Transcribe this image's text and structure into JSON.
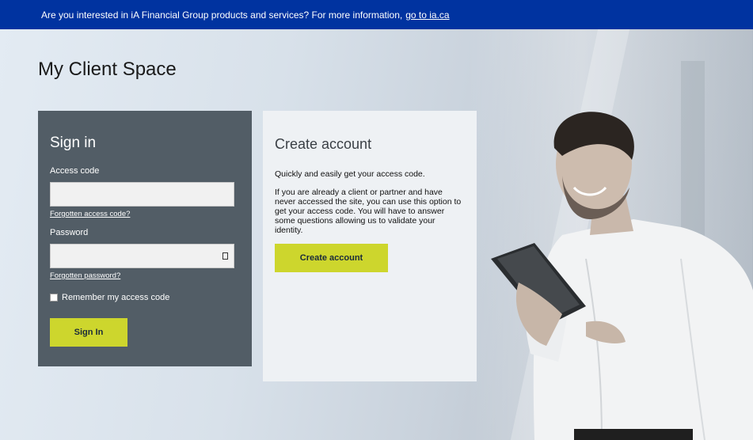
{
  "banner": {
    "text": "Are you interested in iA Financial Group products and services? For more information,",
    "link_text": "go to ia.ca"
  },
  "page_title": "My Client Space",
  "signin": {
    "heading": "Sign in",
    "access_code_label": "Access code",
    "forgot_access_code": "Forgotten access code?",
    "password_label": "Password",
    "forgot_password": "Forgotten password?",
    "remember_label": "Remember my access code",
    "button_label": "Sign In"
  },
  "create_account": {
    "heading": "Create account",
    "intro": "Quickly and easily get your access code.",
    "body": "If you are already a client or partner and have never accessed the site, you can use this option to get your access code. You will have to answer some questions allowing us to validate your identity.",
    "button_label": "Create account"
  },
  "colors": {
    "banner": "#0033a0",
    "signin_panel": "#525d66",
    "accent_button": "#cdd62d"
  }
}
